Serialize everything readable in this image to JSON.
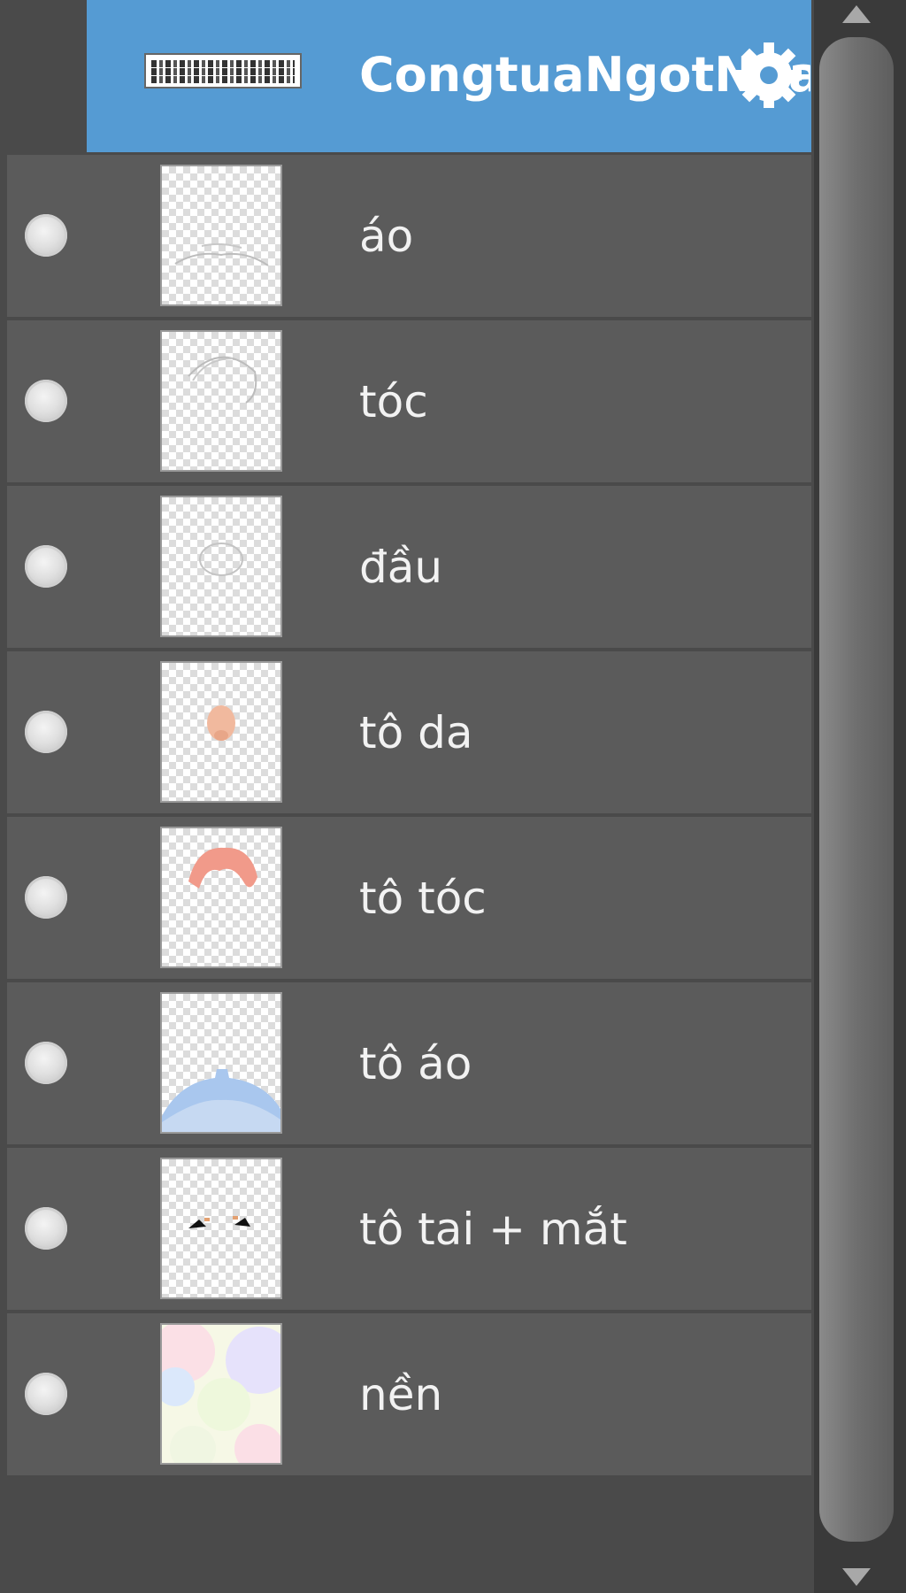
{
  "layers_panel": {
    "selected_layer": {
      "name": "CongtuaNgotNga",
      "icon": "gear-icon"
    },
    "layers": [
      {
        "name": "áo",
        "thumb": "line-sketch"
      },
      {
        "name": "tóc",
        "thumb": "line-sketch"
      },
      {
        "name": "đầu",
        "thumb": "line-sketch"
      },
      {
        "name": "tô da",
        "thumb": "skin-color"
      },
      {
        "name": "tô tóc",
        "thumb": "hair-color"
      },
      {
        "name": "tô áo",
        "thumb": "shirt-color"
      },
      {
        "name": "tô tai + mắt",
        "thumb": "ear-eye"
      },
      {
        "name": "nền",
        "thumb": "background-pastel"
      }
    ],
    "colors": {
      "selected": "#559bd3",
      "row": "#5b5b5b",
      "panel": "#4a4a4a",
      "text": "#f2f2f2"
    }
  },
  "scrollbar": {
    "up_icon": "arrow-up-icon",
    "down_icon": "arrow-down-icon"
  }
}
